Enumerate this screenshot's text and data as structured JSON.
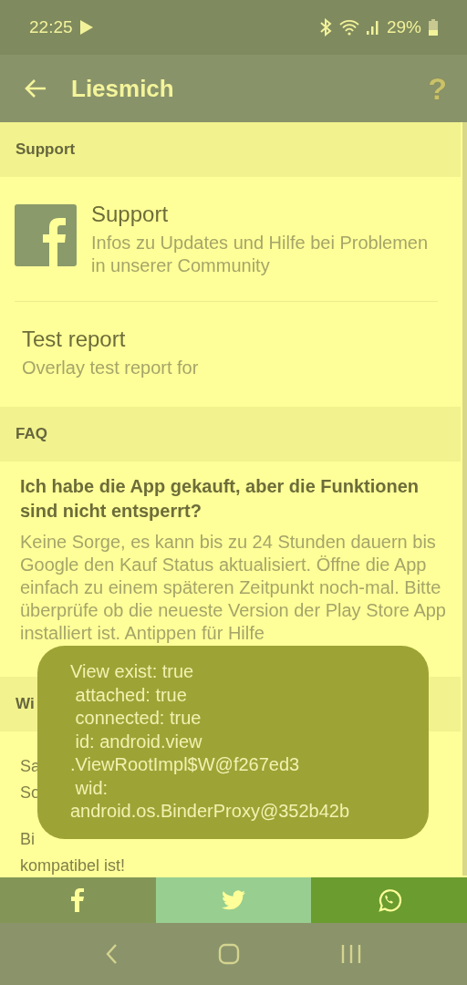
{
  "status_bar": {
    "time": "22:25",
    "battery": "29%"
  },
  "app_bar": {
    "title": "Liesmich",
    "help": "?"
  },
  "sections": [
    {
      "header": "Support",
      "items": [
        {
          "kind": "icon",
          "title": "Support",
          "text": "Infos zu Updates und Hilfe bei Problemen in unserer Community"
        },
        {
          "kind": "plain",
          "title": "Test report",
          "text": "Overlay test report for"
        }
      ]
    },
    {
      "header": "FAQ",
      "items": [
        {
          "kind": "faq",
          "title": "Ich habe die App gekauft, aber die Funktionen sind nicht entsperrt?",
          "text": "Keine Sorge, es kann bis zu 24 Stunden dauern bis Google den Kauf Status aktualisiert. Öffne die App einfach zu einem späteren Zeitpunkt noch-mal. Bitte überprüfe ob die neueste Version der Play Store App installiert ist. Antippen für Hilfe"
        }
      ]
    },
    {
      "header": "Wi",
      "items": [
        {
          "kind": "notice",
          "lines": [
            "Sa",
            "So"
          ]
        },
        {
          "kind": "notice",
          "lines": [
            "Bi",
            "kompatibel ist!"
          ]
        }
      ]
    }
  ],
  "share_bar": [
    {
      "kind": "facebook",
      "color": "#849657"
    },
    {
      "kind": "twitter",
      "color": "#98ce90"
    },
    {
      "kind": "whatsapp",
      "color": "#6a9c30"
    }
  ],
  "toast": {
    "text": "View exist: true\n attached: true\n connected: true\n id: android.view\n.ViewRootImpl$W@f267ed3\n wid:\nandroid.os.BinderProxy@352b42b"
  }
}
